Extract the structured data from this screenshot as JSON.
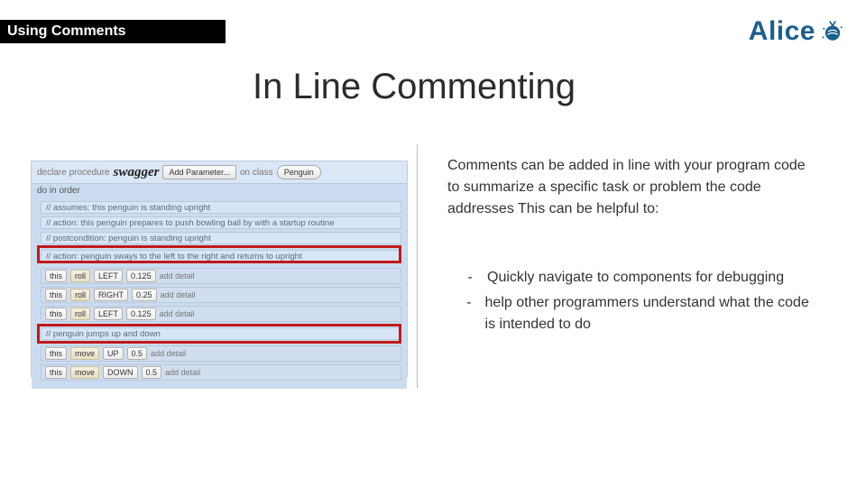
{
  "header": {
    "label": "Using Comments"
  },
  "logo": {
    "text": "Alice"
  },
  "title": "In Line Commenting",
  "body": {
    "intro": "Comments can be added in line with your program code to summarize a specific task or problem the code addresses  This can be helpful to:",
    "bullets": [
      "Quickly navigate to components for debugging",
      "help other programmers understand what the code is intended to do"
    ],
    "dash": "-"
  },
  "code": {
    "declare": "declare procedure",
    "proc_name": "swagger",
    "add_param": "Add Parameter...",
    "on_class": "on class",
    "class_name": "Penguin",
    "do": "do in order",
    "comments": [
      "// assumes: this penguin is standing upright",
      "// action: this penguin prepares to push bowling ball by with a startup routine",
      "// postcondition: penguin is standing upright",
      "// action: penguin sways to the left to the right and returns to upright",
      "// penguin jumps up and down"
    ],
    "statements": [
      {
        "obj": "this",
        "verb": "roll",
        "arg1": "LEFT",
        "arg2": "0.125",
        "detail": "add detail"
      },
      {
        "obj": "this",
        "verb": "roll",
        "arg1": "RIGHT",
        "arg2": "0.25",
        "detail": "add detail"
      },
      {
        "obj": "this",
        "verb": "roll",
        "arg1": "LEFT",
        "arg2": "0.125",
        "detail": "add detail"
      },
      {
        "obj": "this",
        "verb": "move",
        "arg1": "UP",
        "arg2": "0.5",
        "detail": "add detail"
      },
      {
        "obj": "this",
        "verb": "move",
        "arg1": "DOWN",
        "arg2": "0.5",
        "detail": "add detail"
      }
    ]
  }
}
